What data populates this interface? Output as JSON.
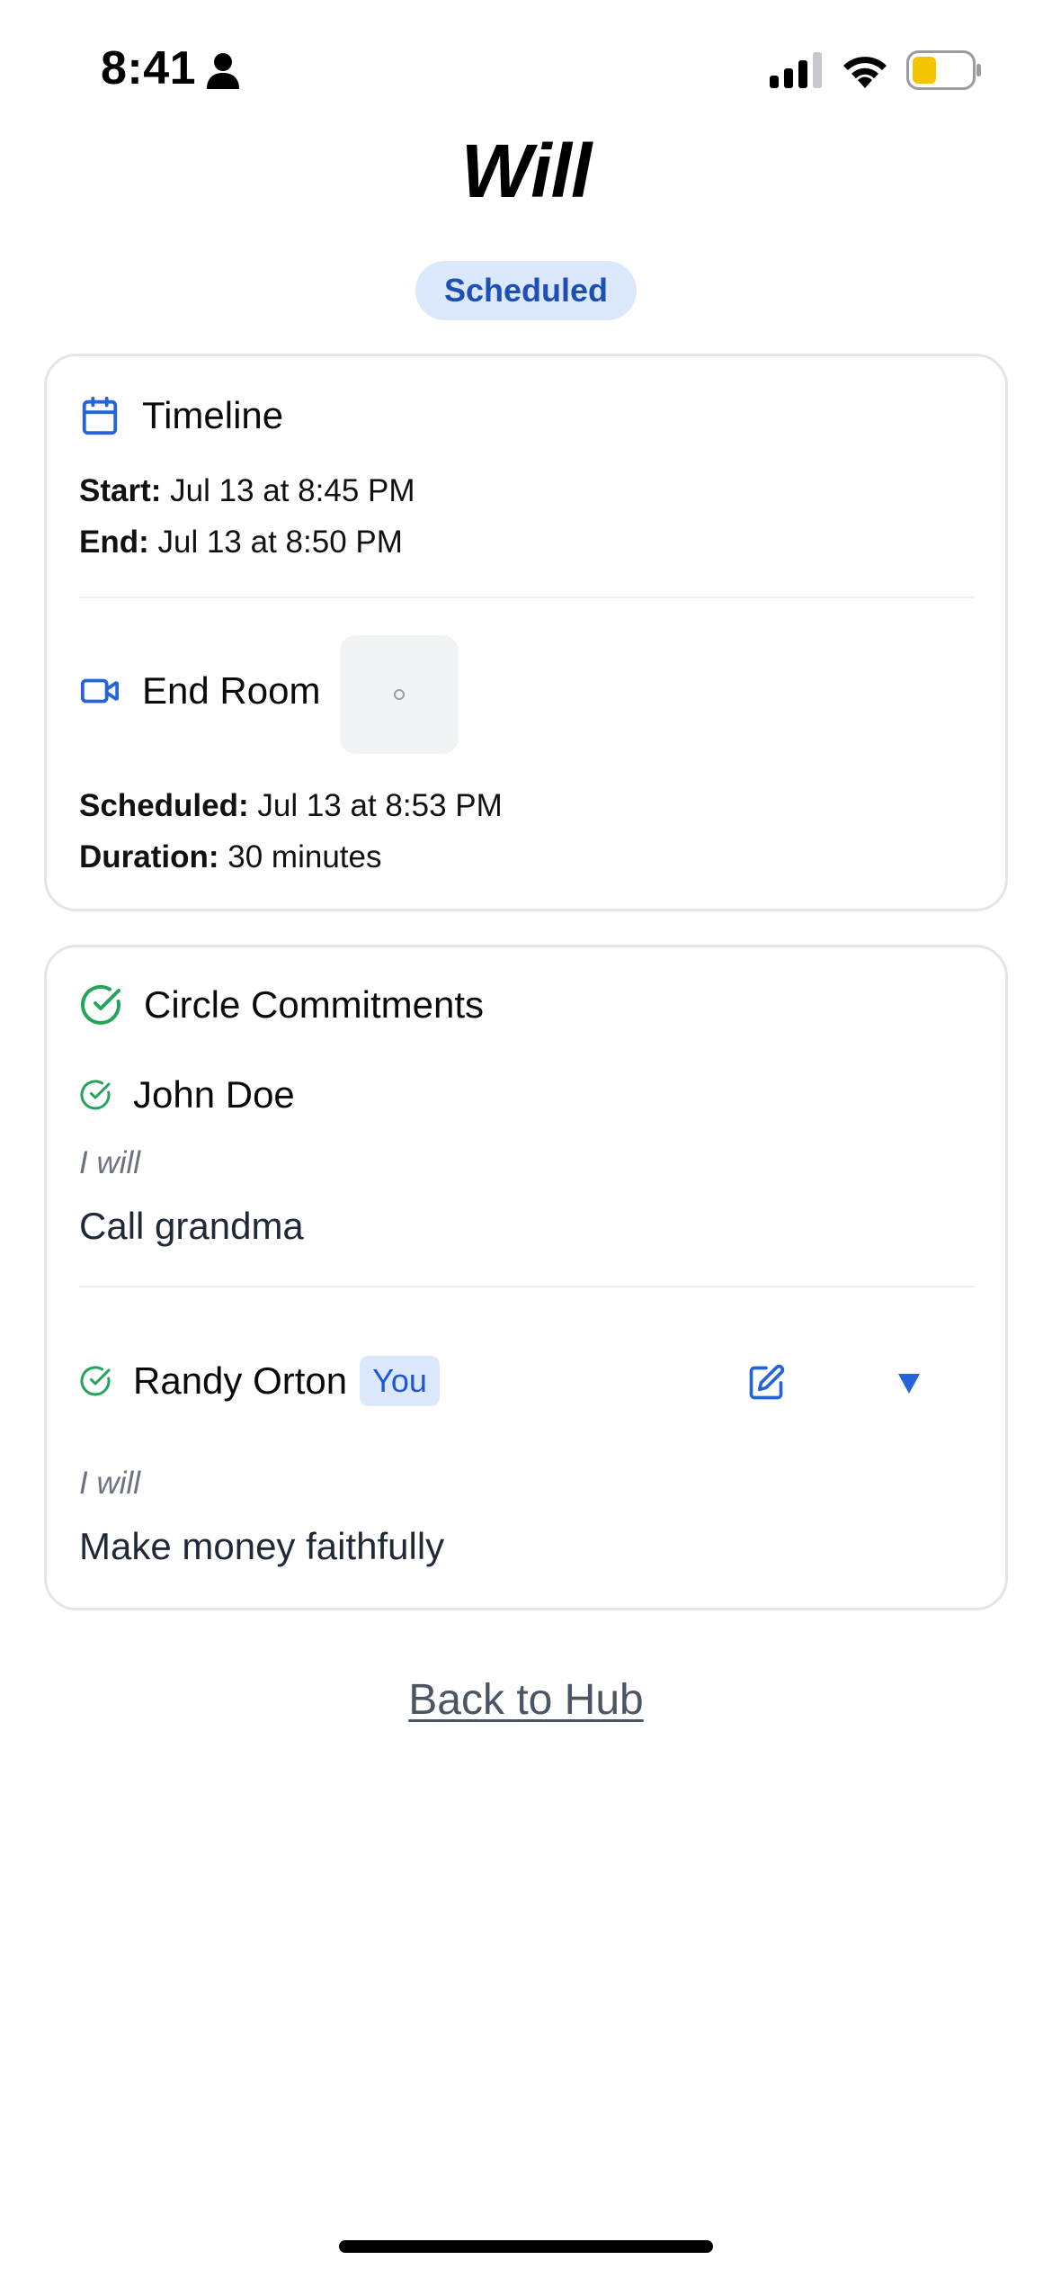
{
  "status_bar": {
    "time": "8:41",
    "icons": [
      "person-icon",
      "cellular-signal-icon",
      "wifi-icon",
      "battery-icon"
    ],
    "battery_color": "#f5c400",
    "battery_level": 0.4
  },
  "header": {
    "title": "Will",
    "status_badge": "Scheduled"
  },
  "timeline": {
    "title": "Timeline",
    "icon": "calendar-icon",
    "start_label": "Start:",
    "start_value": "Jul 13 at 8:45 PM",
    "end_label": "End:",
    "end_value": "Jul 13 at 8:50 PM"
  },
  "end_room": {
    "title": "End Room",
    "icon": "video-camera-icon",
    "scheduled_label": "Scheduled:",
    "scheduled_value": "Jul 13 at 8:53 PM",
    "duration_label": "Duration:",
    "duration_value": "30 minutes"
  },
  "commitments": {
    "title": "Circle Commitments",
    "icon": "check-circle-icon",
    "members": [
      {
        "name": "John Doe",
        "will_label": "I will",
        "commitment": "Call grandma",
        "is_you": false
      },
      {
        "name": "Randy Orton",
        "you_badge": "You",
        "will_label": "I will",
        "commitment": "Make money faithfully",
        "is_you": true
      }
    ]
  },
  "footer": {
    "back_link": "Back to Hub"
  },
  "colors": {
    "accent_blue": "#2563d9",
    "success_green": "#22a559",
    "badge_bg": "#dbe8fb",
    "card_border": "#e3e5e9",
    "muted_text": "#6b7280"
  }
}
